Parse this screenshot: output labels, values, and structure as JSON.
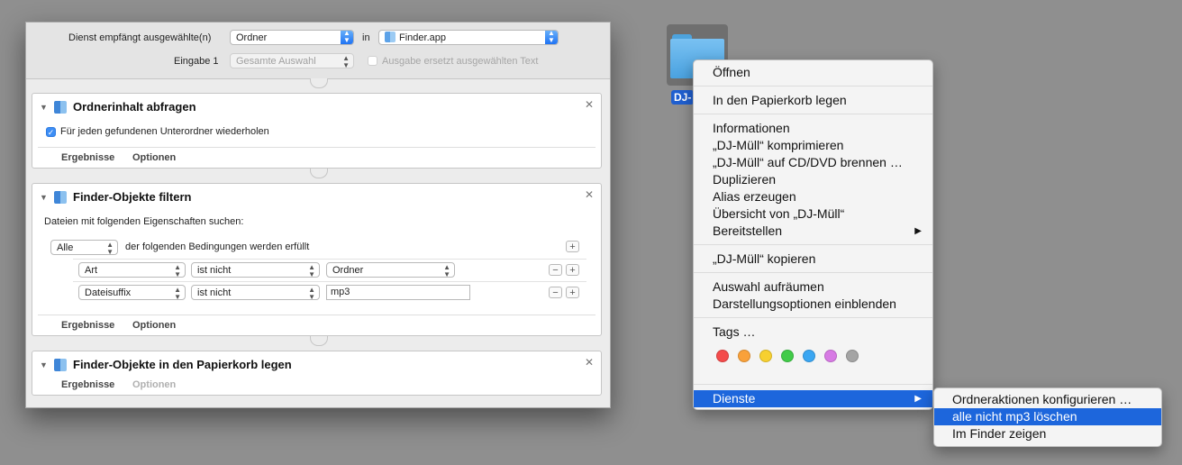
{
  "workflow": {
    "header": {
      "receives_label": "Dienst empfängt ausgewählte(n)",
      "receives_value": "Ordner",
      "in_label": "in",
      "app_value": "Finder.app",
      "input_label": "Eingabe 1",
      "input_value": "Gesamte Auswahl",
      "replace_label": "Ausgabe ersetzt ausgewählten Text"
    },
    "actions": [
      {
        "title": "Ordnerinhalt abfragen",
        "checkbox_label": "Für jeden gefundenen Unterordner wiederholen",
        "tab_results": "Ergebnisse",
        "tab_options": "Optionen"
      },
      {
        "title": "Finder-Objekte filtern",
        "description": "Dateien mit folgenden Eigenschaften suchen:",
        "match_value": "Alle",
        "match_suffix": "der folgenden Bedingungen werden erfüllt",
        "conditions": [
          {
            "attribute": "Art",
            "operator": "ist nicht",
            "value": "Ordner"
          },
          {
            "attribute": "Dateisuffix",
            "operator": "ist nicht",
            "value": "mp3"
          }
        ],
        "tab_results": "Ergebnisse",
        "tab_options": "Optionen"
      },
      {
        "title": "Finder-Objekte in den Papierkorb legen",
        "tab_results": "Ergebnisse",
        "tab_options": "Optionen"
      }
    ]
  },
  "desktop": {
    "folder_label": "DJ-"
  },
  "context_menu": {
    "open": "Öffnen",
    "trash": "In den Papierkorb legen",
    "info": "Informationen",
    "compress": "„DJ-Müll“ komprimieren",
    "burn": "„DJ-Müll“ auf CD/DVD brennen …",
    "duplicate": "Duplizieren",
    "alias": "Alias erzeugen",
    "quicklook": "Übersicht von „DJ-Müll“",
    "share": "Bereitstellen",
    "copy": "„DJ-Müll“ kopieren",
    "cleanup": "Auswahl aufräumen",
    "view_options": "Darstellungsoptionen einblenden",
    "tags": "Tags …",
    "tag_colors": [
      "#f44b4b",
      "#f9a13a",
      "#f7d030",
      "#41cb48",
      "#3aa6f2",
      "#d77ae4",
      "#a4a4a4"
    ],
    "services": "Dienste"
  },
  "services_menu": {
    "items": [
      "Ordneraktionen konfigurieren …",
      "alle nicht mp3 löschen",
      "Im Finder zeigen"
    ]
  }
}
